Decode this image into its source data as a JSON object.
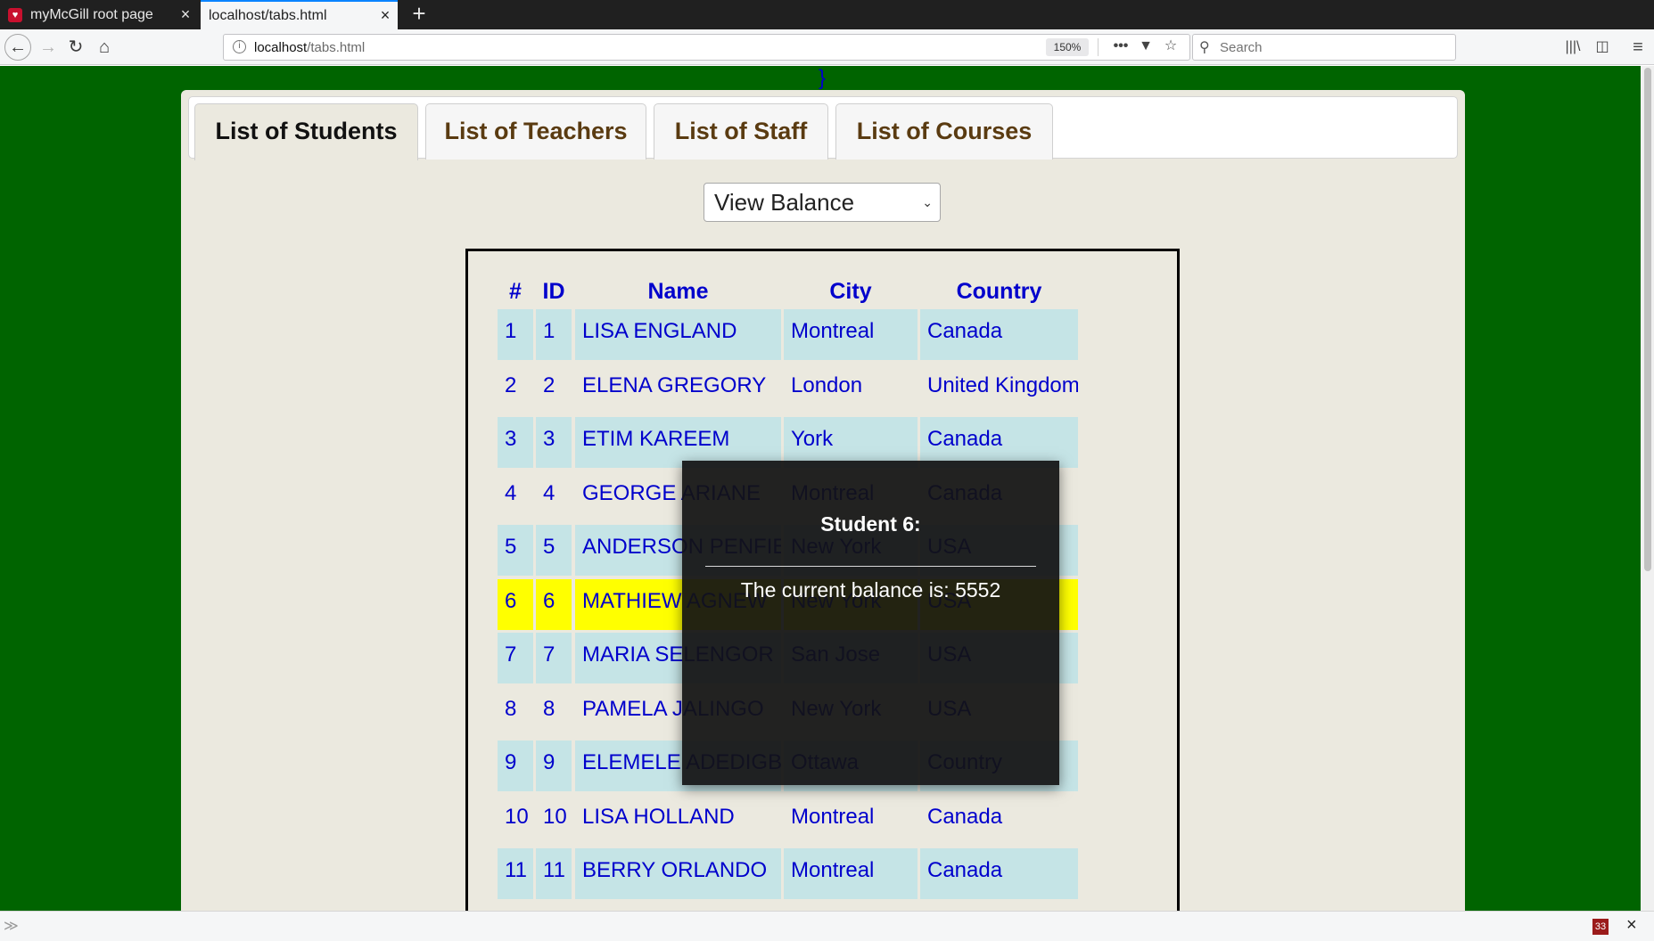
{
  "browser": {
    "tabs": [
      {
        "title": "myMcGill root page",
        "favicon": "mcgill-shield-icon"
      },
      {
        "title": "localhost/tabs.html"
      }
    ],
    "tab_close": "×",
    "new_tab": "+",
    "url_host": "localhost",
    "url_path": "/tabs.html",
    "zoom": "150%",
    "search_placeholder": "Search",
    "icons": {
      "back": "←",
      "forward": "→",
      "reload": "↻",
      "home": "⌂",
      "info": "i",
      "more": "•••",
      "pocket": "▼",
      "star": "☆",
      "search": "⚲",
      "library": "|||\\",
      "sidebar": "◫",
      "menu": "≡"
    }
  },
  "page": {
    "stray_text": "}",
    "tabs": [
      "List of Students",
      "List of Teachers",
      "List of Staff",
      "List of Courses"
    ],
    "select": {
      "value": "View Balance",
      "arrow": "⌄"
    },
    "table": {
      "headers": [
        "#",
        "ID",
        "Name",
        "City",
        "Country"
      ],
      "rows": [
        [
          "1",
          "1",
          "LISA ENGLAND",
          "Montreal",
          "Canada"
        ],
        [
          "2",
          "2",
          "ELENA GREGORY",
          "London",
          "United Kingdom"
        ],
        [
          "3",
          "3",
          "ETIM KAREEM",
          "York",
          "Canada"
        ],
        [
          "4",
          "4",
          "GEORGE ARIANE",
          "Montreal",
          "Canada"
        ],
        [
          "5",
          "5",
          "ANDERSON PENFIELD",
          "New York",
          "USA"
        ],
        [
          "6",
          "6",
          "MATHIEW AGNEW",
          "New York",
          "USA"
        ],
        [
          "7",
          "7",
          "MARIA SELENGOR",
          "San Jose",
          "USA"
        ],
        [
          "8",
          "8",
          "PAMELA JALINGO",
          "New York",
          "USA"
        ],
        [
          "9",
          "9",
          "ELEMELE ADEDIGBA",
          "Ottawa",
          "Country"
        ],
        [
          "10",
          "10",
          "LISA HOLLAND",
          "Montreal",
          "Canada"
        ],
        [
          "11",
          "11",
          "BERRY ORLANDO",
          "Montreal",
          "Canada"
        ]
      ]
    },
    "modal": {
      "title": "Student 6:",
      "message": "The current balance is: 5552"
    }
  },
  "statusbar": {
    "arrow": "≫",
    "badge": "33",
    "close": "×"
  },
  "colors": {
    "page_background": "#006400",
    "link_blue": "#0000cc",
    "row_tint": "#c5e4e6",
    "row_highlight": "#ffff00"
  }
}
